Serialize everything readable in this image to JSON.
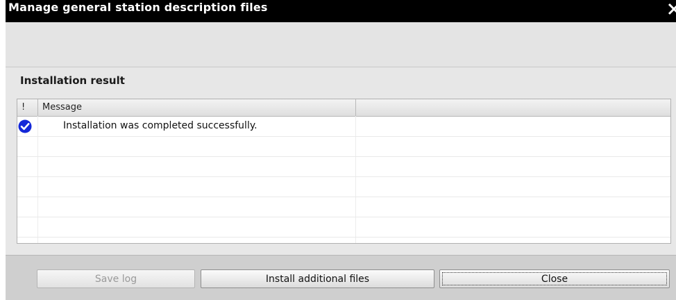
{
  "window": {
    "title": "Manage general station description files"
  },
  "result": {
    "section_title": "Installation result",
    "columns": [
      "!",
      "Message",
      ""
    ],
    "rows": [
      {
        "status_icon": "check-circle-icon",
        "message": "Installation was completed successfully."
      }
    ],
    "empty_rows": 7
  },
  "footer": {
    "save_log_label": "Save log",
    "install_label": "Install additional files",
    "close_label": "Close"
  },
  "colors": {
    "title_bar": "#000000",
    "check_icon": "#1428d8",
    "background": "#e4e4e4"
  }
}
